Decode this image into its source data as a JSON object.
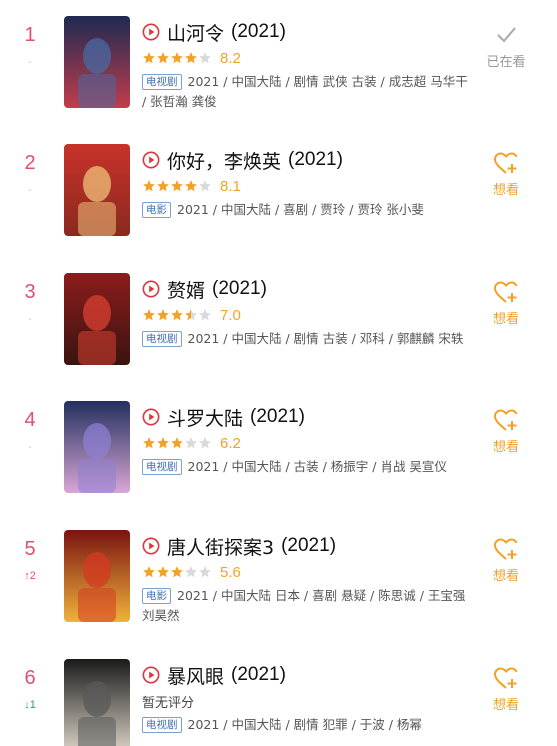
{
  "items": [
    {
      "rank": "1",
      "change": "-",
      "change_dir": "same",
      "title": "山河令",
      "year": "(2021)",
      "stars": 4,
      "score": "8.2",
      "badge": "电视剧",
      "meta": "2021 / 中国大陆 / 剧情 武侠 古装 / 成志超 马华干 / 张哲瀚 龚俊",
      "action": "已在看",
      "action_type": "seen",
      "poster_colors": [
        "#1d2a52",
        "#4a6aa3",
        "#c23d4c"
      ]
    },
    {
      "rank": "2",
      "change": "-",
      "change_dir": "same",
      "title": "你好，李焕英",
      "year": "(2021)",
      "stars": 4,
      "score": "8.1",
      "badge": "电影",
      "meta": "2021 / 中国大陆 / 喜剧 / 贾玲 / 贾玲 张小斐",
      "action": "想看",
      "action_type": "want",
      "poster_colors": [
        "#c8322a",
        "#f0c27a",
        "#8a2a1f"
      ]
    },
    {
      "rank": "3",
      "change": "-",
      "change_dir": "same",
      "title": "赘婿",
      "year": "(2021)",
      "stars": 3.5,
      "score": "7.0",
      "badge": "电视剧",
      "meta": "2021 / 中国大陆 / 剧情 古装 / 邓科 / 郭麒麟 宋轶",
      "action": "想看",
      "action_type": "want",
      "poster_colors": [
        "#8c1c1c",
        "#d94032",
        "#3a1410"
      ]
    },
    {
      "rank": "4",
      "change": "-",
      "change_dir": "same",
      "title": "斗罗大陆",
      "year": "(2021)",
      "stars": 3,
      "score": "6.2",
      "badge": "电视剧",
      "meta": "2021 / 中国大陆 / 古装 / 杨振宇 / 肖战 吴宣仪",
      "action": "想看",
      "action_type": "want",
      "poster_colors": [
        "#23305e",
        "#8f7fd1",
        "#d9a6d6"
      ]
    },
    {
      "rank": "5",
      "change": "↑2",
      "change_dir": "up",
      "title": "唐人街探案3",
      "year": "(2021)",
      "stars": 3,
      "score": "5.6",
      "badge": "电影",
      "meta": "2021 / 中国大陆 日本 / 喜剧 悬疑 / 陈思诚 / 王宝强 刘昊然",
      "action": "想看",
      "action_type": "want",
      "poster_colors": [
        "#7a1410",
        "#d53a22",
        "#f0b23a"
      ]
    },
    {
      "rank": "6",
      "change": "↓1",
      "change_dir": "down",
      "title": "暴风眼",
      "year": "(2021)",
      "stars": 0,
      "score": "",
      "noscore": "暂无评分",
      "badge": "电视剧",
      "meta": "2021 / 中国大陆 / 剧情 犯罪 / 于波 / 杨幂",
      "action": "想看",
      "action_type": "want",
      "poster_colors": [
        "#1a1a1a",
        "#5a5a5a",
        "#d8d0c4"
      ]
    }
  ],
  "colors": {
    "rank": "#e2506b",
    "want": "#f0a227",
    "star": "#f3a229",
    "badge": "#3f6fb3"
  }
}
